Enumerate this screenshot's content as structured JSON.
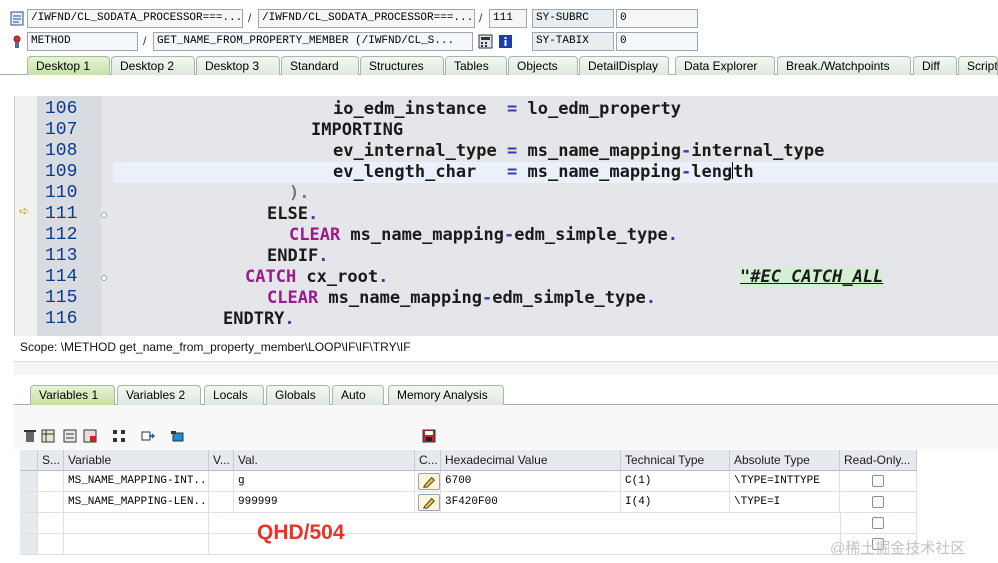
{
  "header": {
    "row1": {
      "program": "/IWFND/CL_SODATA_PROCESSOR===...",
      "include": "/IWFND/CL_SODATA_PROCESSOR===...",
      "line": "111",
      "sysfield_name": "SY-SUBRC",
      "sysfield_value": "0"
    },
    "row2": {
      "event_type": "METHOD",
      "event_name": "GET_NAME_FROM_PROPERTY_MEMBER (/IWFND/CL_S...",
      "sysfield_name": "SY-TABIX",
      "sysfield_value": "0"
    },
    "separator": "/"
  },
  "desktop_tabs": [
    {
      "label": "Desktop 1"
    },
    {
      "label": "Desktop 2"
    },
    {
      "label": "Desktop 3"
    },
    {
      "label": "Standard"
    },
    {
      "label": "Structures"
    },
    {
      "label": "Tables"
    },
    {
      "label": "Objects"
    },
    {
      "label": "DetailDisplay"
    },
    {
      "label": "Data Explorer"
    },
    {
      "label": "Break./Watchpoints"
    },
    {
      "label": "Diff"
    },
    {
      "label": "Script"
    }
  ],
  "code": {
    "lines": [
      {
        "num": "106",
        "text": "io_edm_instance  = lo_edm_property"
      },
      {
        "num": "107",
        "text": "IMPORTING"
      },
      {
        "num": "108",
        "text": "ev_internal_type = ms_name_mapping-internal_type"
      },
      {
        "num": "109",
        "text": "ev_length_char   = ms_name_mapping-length"
      },
      {
        "num": "110",
        "text": ")."
      },
      {
        "num": "111",
        "text": "ELSE."
      },
      {
        "num": "112",
        "text": "CLEAR ms_name_mapping-edm_simple_type."
      },
      {
        "num": "113",
        "text": "ENDIF."
      },
      {
        "num": "114",
        "text": "CATCH cx_root.",
        "comment": "\"#EC CATCH_ALL"
      },
      {
        "num": "115",
        "text": "CLEAR ms_name_mapping-edm_simple_type."
      },
      {
        "num": "116",
        "text": "ENDTRY."
      }
    ]
  },
  "scope": "Scope: \\METHOD get_name_from_property_member\\LOOP\\IF\\IF\\TRY\\IF",
  "variable_tabs": [
    {
      "label": "Variables 1"
    },
    {
      "label": "Variables 2"
    },
    {
      "label": "Locals"
    },
    {
      "label": "Globals"
    },
    {
      "label": "Auto"
    },
    {
      "label": "Memory Analysis"
    }
  ],
  "toolbar_icons": [
    "delete-icon",
    "table-view-icon",
    "structure-icon",
    "export-icon",
    "hierarchy-icon",
    "navigate-icon",
    "folder-icon",
    "save-icon"
  ],
  "grid": {
    "columns": [
      {
        "label": "S..."
      },
      {
        "label": "Variable"
      },
      {
        "label": "V..."
      },
      {
        "label": "Val."
      },
      {
        "label": "C..."
      },
      {
        "label": "Hexadecimal Value"
      },
      {
        "label": "Technical Type"
      },
      {
        "label": "Absolute Type"
      },
      {
        "label": "Read-Only..."
      }
    ],
    "rows": [
      {
        "variable": "MS_NAME_MAPPING-INT...",
        "value": "g",
        "hex": "6700",
        "tech_type": "C(1)",
        "abs_type": "\\TYPE=INTTYPE"
      },
      {
        "variable": "MS_NAME_MAPPING-LEN...",
        "value": "999999",
        "hex": "3F420F00",
        "tech_type": "I(4)",
        "abs_type": "\\TYPE=I"
      }
    ]
  },
  "overlay_label": "QHD/504",
  "watermark": "@稀土掘金技术社区",
  "colors": {
    "keyword": "#9b1b8c",
    "comment": "#1c7e2e",
    "line_number": "#0a3a8c",
    "overlay": "#e8332b"
  }
}
